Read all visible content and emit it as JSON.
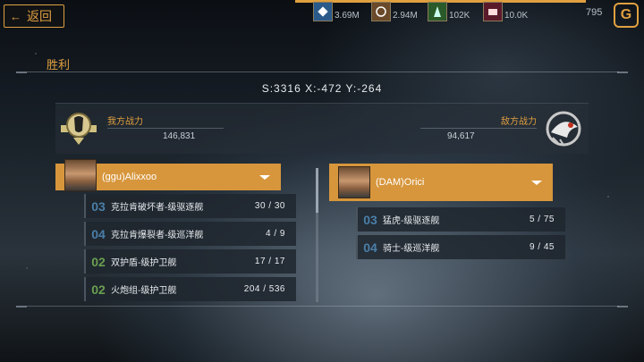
{
  "header": {
    "back_label": "返回",
    "back_arrow": "←"
  },
  "resources": [
    {
      "icon": "blue-crystal-icon",
      "value": "3.69M",
      "color": "#3a6fa5"
    },
    {
      "icon": "brown-ore-icon",
      "value": "2.94M",
      "color": "#a87a3a"
    },
    {
      "icon": "green-gas-icon",
      "value": "102K",
      "color": "#4a8a4a"
    },
    {
      "icon": "red-cargo-icon",
      "value": "10.0K",
      "color": "#8a2a4a"
    }
  ],
  "premium": {
    "count": "795",
    "logo": "G"
  },
  "panel": {
    "title": "胜利",
    "coords": "S:3316  X:-472  Y:-264"
  },
  "power": {
    "our_label": "我方战力",
    "our_value": "146,831",
    "enemy_label": "敌方战力",
    "enemy_value": "94,617"
  },
  "fleets": {
    "left": {
      "commander": "(ggu)Alixxoo",
      "ships": [
        {
          "level": "03",
          "name": "克拉肯破坏者-级驱逐舰",
          "count": "30 / 30",
          "color": "blue"
        },
        {
          "level": "04",
          "name": "克拉肯爆裂者-级巡洋舰",
          "count": "4 / 9",
          "color": "blue"
        },
        {
          "level": "02",
          "name": "双护盾-级护卫舰",
          "count": "17 / 17",
          "color": "green"
        },
        {
          "level": "02",
          "name": "火炮组-级护卫舰",
          "count": "204 / 536",
          "color": "green"
        }
      ]
    },
    "right": {
      "commander": "(DAM)Orici",
      "ships": [
        {
          "level": "03",
          "name": "猛虎-级驱逐舰",
          "count": "5 / 75",
          "color": "blue"
        },
        {
          "level": "04",
          "name": "骑士-级巡洋舰",
          "count": "9 / 45",
          "color": "blue"
        }
      ]
    }
  }
}
